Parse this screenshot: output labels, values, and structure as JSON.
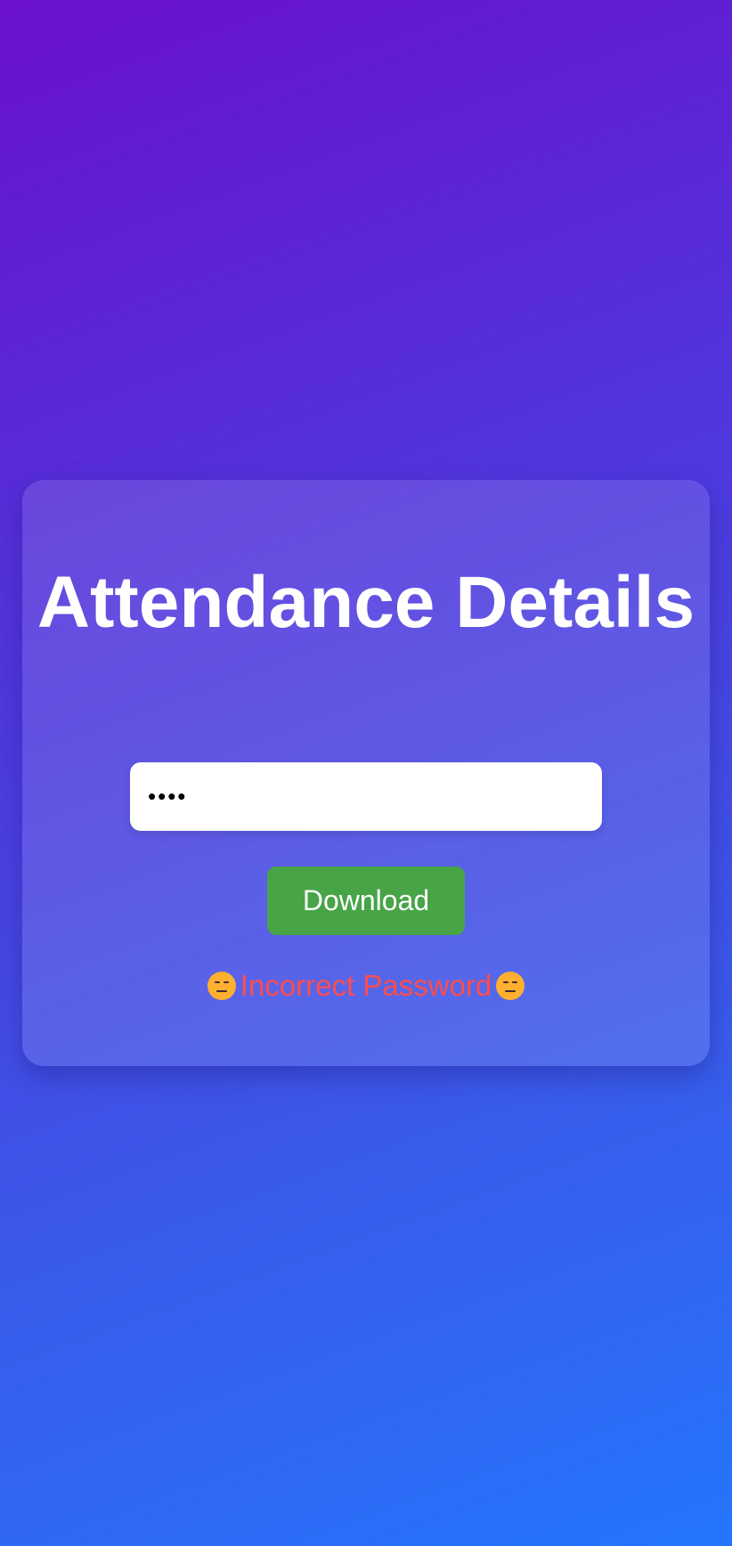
{
  "card": {
    "title": "Attendance Details",
    "password": {
      "value": "1234",
      "placeholder": ""
    },
    "download_label": "Download",
    "error": {
      "text": "Incorrect Password",
      "icon": "expressionless-face-icon",
      "color": "#ff4d4d"
    }
  },
  "colors": {
    "gradient_start": "#6a11cb",
    "gradient_end": "#2575fc",
    "button": "#47a447"
  }
}
